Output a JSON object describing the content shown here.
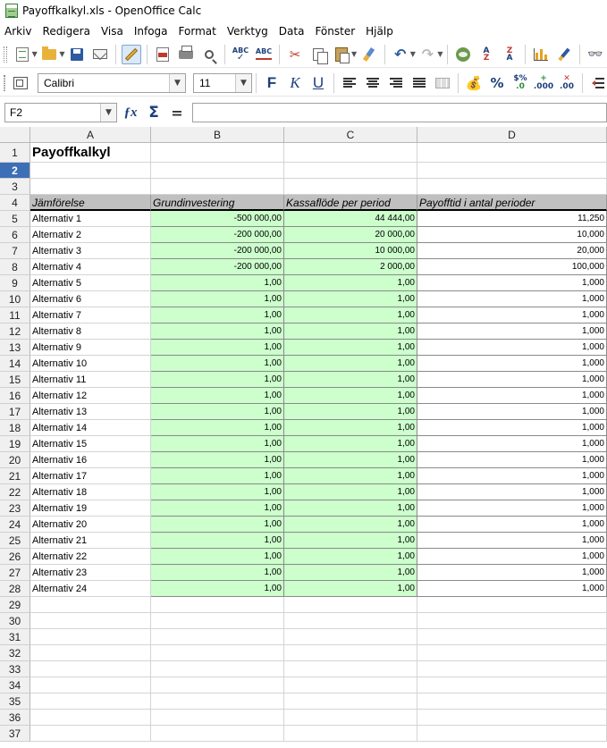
{
  "window": {
    "title": "Payoffkalkyl.xls - OpenOffice Calc"
  },
  "menu": [
    "Arkiv",
    "Redigera",
    "Visa",
    "Infoga",
    "Format",
    "Verktyg",
    "Data",
    "Fönster",
    "Hjälp"
  ],
  "font": {
    "name": "Calibri",
    "size": "11"
  },
  "toolbar": {
    "bold_label": "F",
    "italic_label": "K",
    "underline_label": "U"
  },
  "formula_bar": {
    "cell_ref": "F2",
    "content": ""
  },
  "columns": [
    "A",
    "B",
    "C",
    "D"
  ],
  "sheet": {
    "title": "Payoffkalkyl",
    "headers": [
      "Jämförelse",
      "Grundinvestering",
      "Kassaflöde per period",
      "Payofftid i antal perioder"
    ],
    "rows": [
      [
        "Alternativ 1",
        "-500 000,00",
        "44 444,00",
        "11,250"
      ],
      [
        "Alternativ 2",
        "-200 000,00",
        "20 000,00",
        "10,000"
      ],
      [
        "Alternativ 3",
        "-200 000,00",
        "10 000,00",
        "20,000"
      ],
      [
        "Alternativ 4",
        "-200 000,00",
        "2 000,00",
        "100,000"
      ],
      [
        "Alternativ 5",
        "1,00",
        "1,00",
        "1,000"
      ],
      [
        "Alternativ 6",
        "1,00",
        "1,00",
        "1,000"
      ],
      [
        "Alternativ 7",
        "1,00",
        "1,00",
        "1,000"
      ],
      [
        "Alternativ 8",
        "1,00",
        "1,00",
        "1,000"
      ],
      [
        "Alternativ 9",
        "1,00",
        "1,00",
        "1,000"
      ],
      [
        "Alternativ 10",
        "1,00",
        "1,00",
        "1,000"
      ],
      [
        "Alternativ 11",
        "1,00",
        "1,00",
        "1,000"
      ],
      [
        "Alternativ 12",
        "1,00",
        "1,00",
        "1,000"
      ],
      [
        "Alternativ 13",
        "1,00",
        "1,00",
        "1,000"
      ],
      [
        "Alternativ 14",
        "1,00",
        "1,00",
        "1,000"
      ],
      [
        "Alternativ 15",
        "1,00",
        "1,00",
        "1,000"
      ],
      [
        "Alternativ 16",
        "1,00",
        "1,00",
        "1,000"
      ],
      [
        "Alternativ 17",
        "1,00",
        "1,00",
        "1,000"
      ],
      [
        "Alternativ 18",
        "1,00",
        "1,00",
        "1,000"
      ],
      [
        "Alternativ 19",
        "1,00",
        "1,00",
        "1,000"
      ],
      [
        "Alternativ 20",
        "1,00",
        "1,00",
        "1,000"
      ],
      [
        "Alternativ 21",
        "1,00",
        "1,00",
        "1,000"
      ],
      [
        "Alternativ 22",
        "1,00",
        "1,00",
        "1,000"
      ],
      [
        "Alternativ 23",
        "1,00",
        "1,00",
        "1,000"
      ],
      [
        "Alternativ 24",
        "1,00",
        "1,00",
        "1,000"
      ]
    ],
    "row_numbers": [
      "1",
      "2",
      "3",
      "4",
      "5",
      "6",
      "7",
      "8",
      "9",
      "10",
      "11",
      "12",
      "13",
      "14",
      "15",
      "16",
      "17",
      "18",
      "19",
      "20",
      "21",
      "22",
      "23",
      "24",
      "25",
      "26",
      "27",
      "28",
      "29",
      "30",
      "31",
      "32",
      "33",
      "34",
      "35",
      "36",
      "37"
    ],
    "active_row": "2"
  },
  "colors": {
    "input_fill": "#ccffcc",
    "header_fill": "#c0c0c0",
    "active_row": "#3d6fb6"
  }
}
